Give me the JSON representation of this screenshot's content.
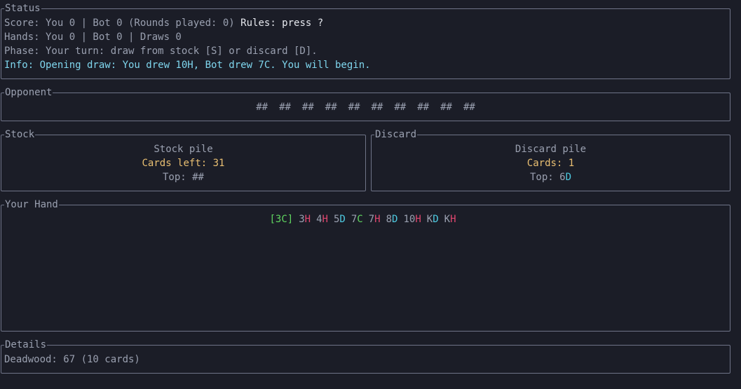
{
  "status": {
    "title": "Status",
    "score_text": "Score: You 0 | Bot 0 (Rounds played: 0)",
    "rules_text": "Rules: press ?",
    "hands_text": "Hands: You 0 | Bot 0 | Draws 0",
    "phase_text": "Phase: Your turn: draw from stock [S] or discard [D].",
    "info_text": "Info: Opening draw: You drew 10H, Bot drew 7C. You will begin."
  },
  "opponent": {
    "title": "Opponent",
    "cards": [
      "##",
      "##",
      "##",
      "##",
      "##",
      "##",
      "##",
      "##",
      "##",
      "##"
    ]
  },
  "stock": {
    "title": "Stock",
    "heading": "Stock pile",
    "cards_left": "Cards left: 31",
    "top_text": "Top: ##"
  },
  "discard": {
    "title": "Discard",
    "heading": "Discard pile",
    "cards": "Cards: 1",
    "top_label": "Top: ",
    "top_rank": "6",
    "top_suit": "D"
  },
  "hand": {
    "title": "Your Hand",
    "cards": [
      {
        "rank": "3",
        "suit": "C",
        "selected": true
      },
      {
        "rank": "3",
        "suit": "H",
        "selected": false
      },
      {
        "rank": "4",
        "suit": "H",
        "selected": false
      },
      {
        "rank": "5",
        "suit": "D",
        "selected": false
      },
      {
        "rank": "7",
        "suit": "C",
        "selected": false
      },
      {
        "rank": "7",
        "suit": "H",
        "selected": false
      },
      {
        "rank": "8",
        "suit": "D",
        "selected": false
      },
      {
        "rank": "10",
        "suit": "H",
        "selected": false
      },
      {
        "rank": "K",
        "suit": "D",
        "selected": false
      },
      {
        "rank": "K",
        "suit": "H",
        "selected": false
      }
    ]
  },
  "details": {
    "title": "Details",
    "deadwood_text": "Deadwood: 67 (10 cards)"
  },
  "colors": {
    "background": "#1b1d27",
    "border": "#6f7488",
    "hearts": "#e0476f",
    "diamonds": "#4ec9e0",
    "clubs": "#60d660",
    "highlight_yellow": "#e9bf72",
    "info_cyan": "#7fd6ee"
  }
}
